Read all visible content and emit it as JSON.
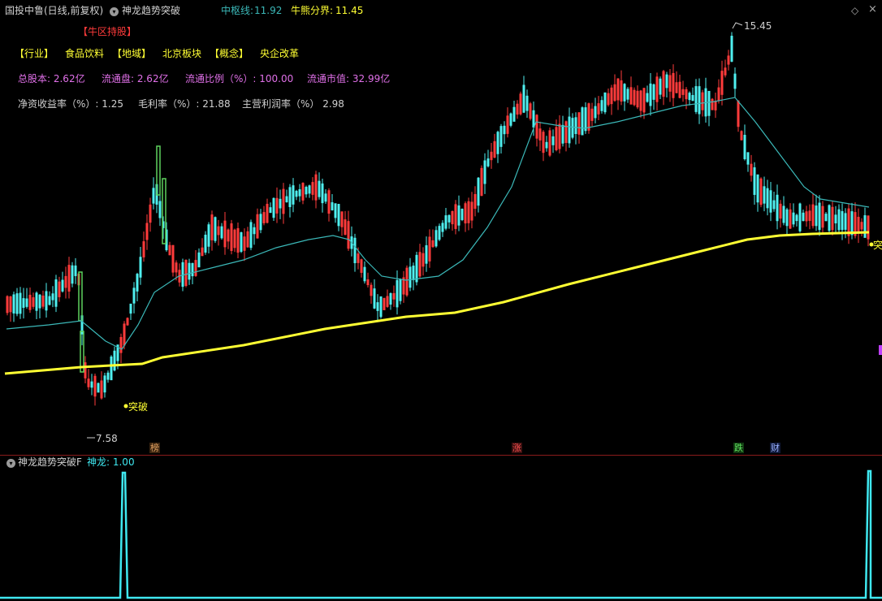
{
  "header": {
    "stock_title": "国投中鲁(日线,前复权)",
    "indicator_name": "神龙趋势突破",
    "mid_label": "中枢线:",
    "mid_value": "11.92",
    "bull_label": "牛熊分界:",
    "bull_value": "11.45",
    "diamond": "◇",
    "close": "×"
  },
  "info": {
    "tag": "【牛区持股】",
    "industry_tag": "【行业】",
    "industry": "食品饮料",
    "region_tag": "【地域】",
    "region": "北京板块",
    "concept_tag": "【概念】",
    "concept": "央企改革",
    "total_shares": "总股本: 2.62亿",
    "float_shares": "流通盘: 2.62亿",
    "float_ratio": "流通比例（%）: 100.00",
    "float_cap": "流通市值: 32.99亿",
    "roe": "净资收益率（%）: 1.25",
    "gross_margin": "毛利率（%）: 21.88",
    "net_margin": "主营利润率（%） 2.98"
  },
  "annotations": {
    "high": "15.45",
    "low": "7.58",
    "breakout": "突破",
    "right_marker": "突"
  },
  "bottom_tags": [
    "榜",
    "涨",
    "跌",
    "财"
  ],
  "indicator": {
    "title": "神龙趋势突破F",
    "value_label": "神龙: 1.00"
  },
  "colors": {
    "up": "#ff3b3b",
    "down": "#4ff0f0",
    "yellow": "#ffff33",
    "ma": "#3bb8b8",
    "indicator": "#3fe8f0",
    "breakout_box": "#5dd15d"
  },
  "chart_data": {
    "type": "candlestick",
    "price_range": [
      7.58,
      15.45
    ],
    "ma_line": [
      9.3,
      9.0,
      9.6,
      10.2,
      10.5,
      10.8,
      11.1,
      11.0,
      11.2,
      11.6,
      11.6,
      11.3,
      10.8,
      11.3,
      12.6,
      13.8,
      14.0,
      14.4,
      14.6,
      14.7,
      14.0,
      13.6,
      13.4,
      13.1
    ],
    "bull_bear_line": [
      8.45,
      8.5,
      8.65,
      8.85,
      9.0,
      9.2,
      9.35,
      9.55,
      9.7,
      10.0,
      10.4,
      10.75,
      11.15,
      11.45,
      11.5
    ],
    "indicator_values": [
      0,
      1,
      0,
      0,
      0,
      0,
      1
    ]
  }
}
